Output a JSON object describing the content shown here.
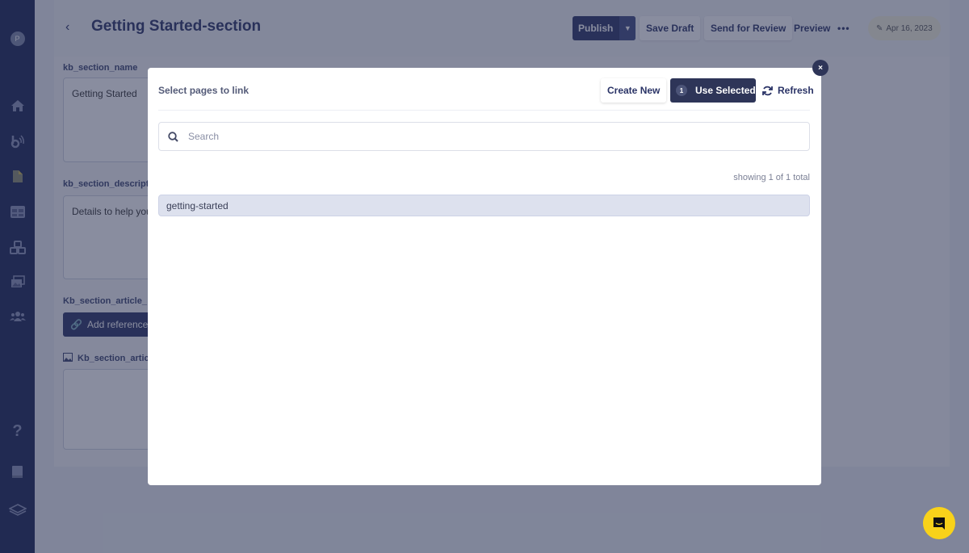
{
  "sidebar": {
    "avatar_initial": "P",
    "items": [
      {
        "name": "home",
        "icon": "home-icon"
      },
      {
        "name": "feeds",
        "icon": "broadcast-icon"
      },
      {
        "name": "pages",
        "icon": "document-icon"
      },
      {
        "name": "layouts",
        "icon": "grid-icon"
      },
      {
        "name": "components",
        "icon": "cubes-icon"
      },
      {
        "name": "media",
        "icon": "image-gallery-icon"
      },
      {
        "name": "users",
        "icon": "users-icon"
      }
    ],
    "bottom_items": [
      {
        "name": "help",
        "icon": "question-icon",
        "glyph": "?"
      },
      {
        "name": "docs",
        "icon": "book-icon"
      },
      {
        "name": "layers",
        "icon": "layers-icon"
      }
    ]
  },
  "header": {
    "back_glyph": "‹",
    "title": "Getting Started-section",
    "publish_label": "Publish",
    "save_draft_label": "Save Draft",
    "send_review_label": "Send for Review",
    "preview_label": "Preview",
    "more_glyph": "•••",
    "date": "Apr 16, 2023"
  },
  "form": {
    "name_label": "kb_section_name",
    "name_value": "Getting Started",
    "description_label": "kb_section_descript",
    "description_value": "Details to help you",
    "articles_label": "Kb_section_article_",
    "add_reference_label": "Add reference",
    "image_label": "Kb_section_artic"
  },
  "modal": {
    "title": "Select pages to link",
    "create_new_label": "Create New",
    "selected_count": "1",
    "use_selected_label": "Use Selected",
    "refresh_label": "Refresh",
    "close_glyph": "×",
    "search_placeholder": "Search",
    "search_value": "",
    "count_text": "showing 1 of 1 total",
    "results": [
      "getting-started"
    ]
  },
  "colors": {
    "primary": "#2a3366",
    "sidebar": "#1a2456",
    "chat": "#f8d21a"
  }
}
